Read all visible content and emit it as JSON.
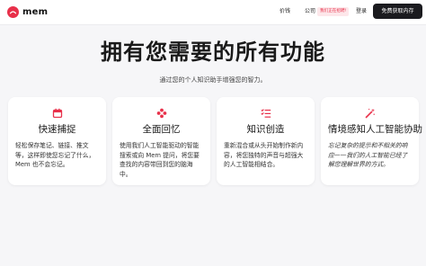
{
  "brand": {
    "name": "mem",
    "color": "#e8304a",
    "logo_icon": "mem-logo-icon"
  },
  "nav": {
    "pricing": "价钱",
    "company": "公司",
    "hiring_badge": "我们正在招聘!",
    "login": "登录",
    "cta": "免费获取内存"
  },
  "hero": {
    "title": "拥有您需要的所有功能",
    "subtitle": "通过您的个人知识助手增强您的智力。"
  },
  "features": [
    {
      "icon": "calendar-icon",
      "title": "快速捕捉",
      "desc": "轻松保存笔记、链接、推文等，这样即使您忘记了什么，Mem 也不会忘记。"
    },
    {
      "icon": "flower-icon",
      "title": "全面回忆",
      "desc": "使用我们人工智能驱动的智能搜索或向 Mem 提问，将您要查找的内容带回到您的脑海中。"
    },
    {
      "icon": "checklist-icon",
      "title": "知识创造",
      "desc": "重新混合或从头开始制作新内容，将您独特的声音与超强大的人工智能相结合。"
    },
    {
      "icon": "magic-wand-icon",
      "title": "情境感知人工智能协助",
      "desc": "忘记复杂的提示和不相关的响应——我们的人工智能已经了解您理解世界的方式。"
    }
  ],
  "accent": "#e8304a"
}
